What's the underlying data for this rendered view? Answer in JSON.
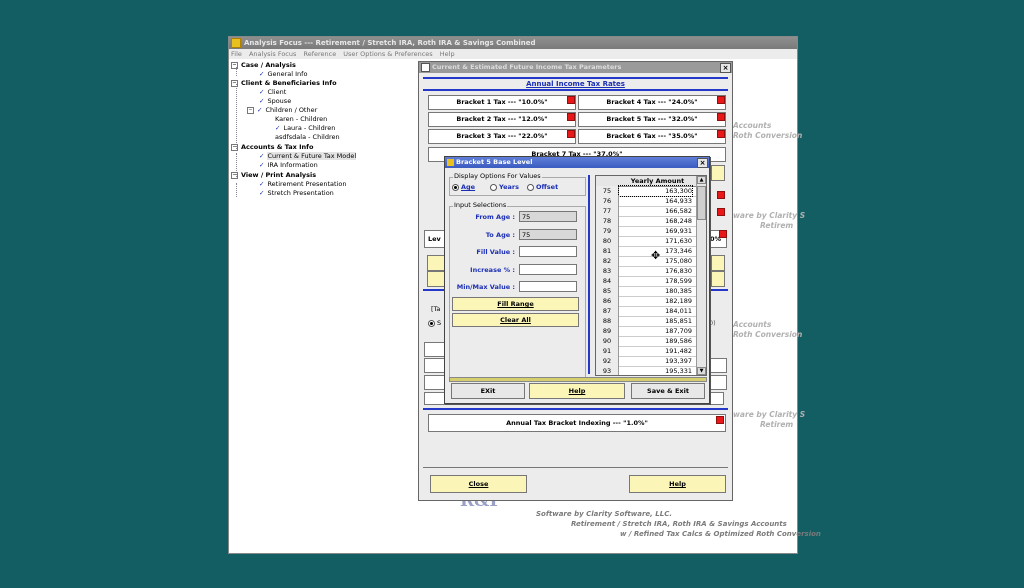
{
  "app": {
    "title": "Analysis Focus --- Retirement / Stretch IRA, Roth IRA & Savings Combined",
    "menu": [
      "File",
      "Analysis Focus",
      "Reference",
      "User Options & Preferences",
      "Help"
    ]
  },
  "tree": {
    "case_analysis": "Case / Analysis",
    "general_info": "General Info",
    "client_beneficiaries": "Client & Beneficiaries Info",
    "client": "Client",
    "spouse": "Spouse",
    "children_other": "Children / Other",
    "karen": "Karen - Children",
    "laura": "Laura - Children",
    "asdfsdala": "asdfsdala - Children",
    "accounts_tax": "Accounts & Tax Info",
    "current_future_tax": "Current & Future Tax Model",
    "ira_information": "IRA Information",
    "view_print": "View / Print Analysis",
    "retirement_presentation": "Retirement Presentation",
    "stretch_presentation": "Stretch Presentation"
  },
  "background": {
    "accounts_1": "Accounts",
    "roth_conv_1": "Roth Conversion",
    "clarity_1": "ware by Clarity S",
    "retirement_1": "Retirem",
    "accounts_2": "Accounts",
    "roth_conv_2": "Roth Conversion",
    "clarity_2": "ware by Clarity S",
    "retirement_2": "Retirem",
    "logo": "R&P",
    "footer_1": "Software by Clarity Software, LLC.",
    "footer_2": "Retirement / Stretch IRA, Roth IRA & Savings Accounts",
    "footer_3": "w / Refined Tax Calcs & Optimized Roth Conversion"
  },
  "tax_window": {
    "title": "Current & Estimated Future Income Tax Parameters",
    "section_title": "Annual Income Tax Rates",
    "brackets": [
      "Bracket 1 Tax --- \"10.0%\"",
      "Bracket 4 Tax --- \"24.0%\"",
      "Bracket 2 Tax --- \"12.0%\"",
      "Bracket 5 Tax --- \"32.0%\"",
      "Bracket 3 Tax --- \"22.0%\"",
      "Bracket 6 Tax --- \"35.0%\"",
      "Bracket 7 Tax --- \"37.0%\""
    ],
    "lev_fragment": "Lev",
    "pct_fragment": "0%",
    "ta_fragment": "[Ta",
    "s_fragment": "S",
    "paren_fragment": "0)",
    "dollar_fragment": "$",
    "indexing": "Annual Tax Bracket Indexing --- \"1.0%\"",
    "close_label": "Close",
    "help_label": "Help"
  },
  "dialog": {
    "title": "Bracket 5 Base Level",
    "display_options_label": "Display Options For Values",
    "radio_age": "Age",
    "radio_years": "Years",
    "radio_offset": "Offset",
    "input_selections_label": "Input Selections",
    "from_age_label": "From Age :",
    "from_age_value": "75",
    "to_age_label": "To Age :",
    "to_age_value": "75",
    "fill_value_label": "Fill Value :",
    "increase_label": "Increase % :",
    "minmax_label": "Min/Max Value :",
    "fill_range_label": "Fill Range",
    "clear_all_label": "Clear All",
    "grid_header": "Yearly Amount",
    "rows": [
      {
        "age": "75",
        "value": "163,300"
      },
      {
        "age": "76",
        "value": "164,933"
      },
      {
        "age": "77",
        "value": "166,582"
      },
      {
        "age": "78",
        "value": "168,248"
      },
      {
        "age": "79",
        "value": "169,931"
      },
      {
        "age": "80",
        "value": "171,630"
      },
      {
        "age": "81",
        "value": "173,346"
      },
      {
        "age": "82",
        "value": "175,080"
      },
      {
        "age": "83",
        "value": "176,830"
      },
      {
        "age": "84",
        "value": "178,599"
      },
      {
        "age": "85",
        "value": "180,385"
      },
      {
        "age": "86",
        "value": "182,189"
      },
      {
        "age": "87",
        "value": "184,011"
      },
      {
        "age": "88",
        "value": "185,851"
      },
      {
        "age": "89",
        "value": "187,709"
      },
      {
        "age": "90",
        "value": "189,586"
      },
      {
        "age": "91",
        "value": "191,482"
      },
      {
        "age": "92",
        "value": "193,397"
      },
      {
        "age": "93",
        "value": "195,331"
      }
    ],
    "exit_label": "EXit",
    "help_label": "Help",
    "save_exit_label": "Save & Exit"
  }
}
